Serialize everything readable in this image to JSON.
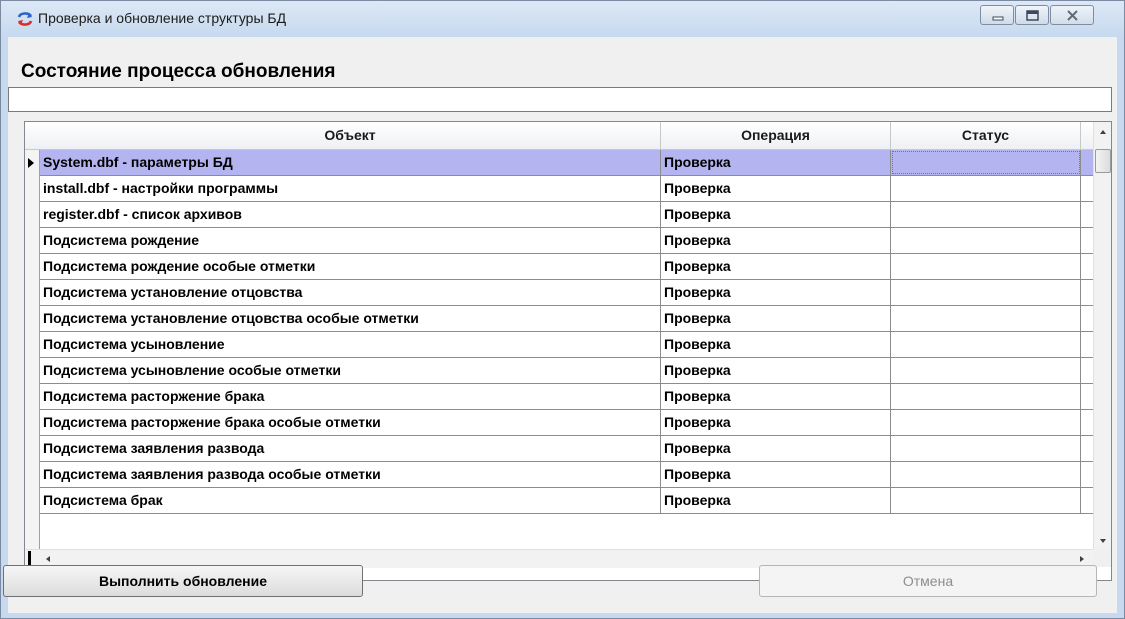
{
  "window": {
    "title": "Проверка и обновление структуры БД"
  },
  "status_section": {
    "heading": "Состояние процесса обновления",
    "progress_text": ""
  },
  "grid": {
    "columns": [
      "Объект",
      "Операция",
      "Статус"
    ],
    "rows": [
      {
        "object": "System.dbf - параметры БД",
        "operation": "Проверка",
        "status": ""
      },
      {
        "object": "install.dbf - настройки программы",
        "operation": "Проверка",
        "status": ""
      },
      {
        "object": "register.dbf - список архивов",
        "operation": "Проверка",
        "status": ""
      },
      {
        "object": "Подсистема рождение",
        "operation": "Проверка",
        "status": ""
      },
      {
        "object": "Подсистема рождение  особые отметки",
        "operation": "Проверка",
        "status": ""
      },
      {
        "object": "Подсистема установление отцовства",
        "operation": "Проверка",
        "status": ""
      },
      {
        "object": "Подсистема установление отцовства особые отметки",
        "operation": "Проверка",
        "status": ""
      },
      {
        "object": "Подсистема усыновление",
        "operation": "Проверка",
        "status": ""
      },
      {
        "object": "Подсистема усыновление особые отметки",
        "operation": "Проверка",
        "status": ""
      },
      {
        "object": "Подсистема расторжение брака",
        "operation": "Проверка",
        "status": ""
      },
      {
        "object": "Подсистема расторжение брака особые отметки",
        "operation": "Проверка",
        "status": ""
      },
      {
        "object": "Подсистема заявления развода",
        "operation": "Проверка",
        "status": ""
      },
      {
        "object": "Подсистема заявления развода особые отметки",
        "operation": "Проверка",
        "status": ""
      },
      {
        "object": "Подсистема брак",
        "operation": "Проверка",
        "status": ""
      }
    ],
    "selected_row": 0
  },
  "buttons": {
    "update_label": "Выполнить обновление",
    "cancel_label": "Отмена"
  },
  "colors": {
    "selection": "#b4b4f0",
    "window_frame": "#c7d9ee"
  }
}
